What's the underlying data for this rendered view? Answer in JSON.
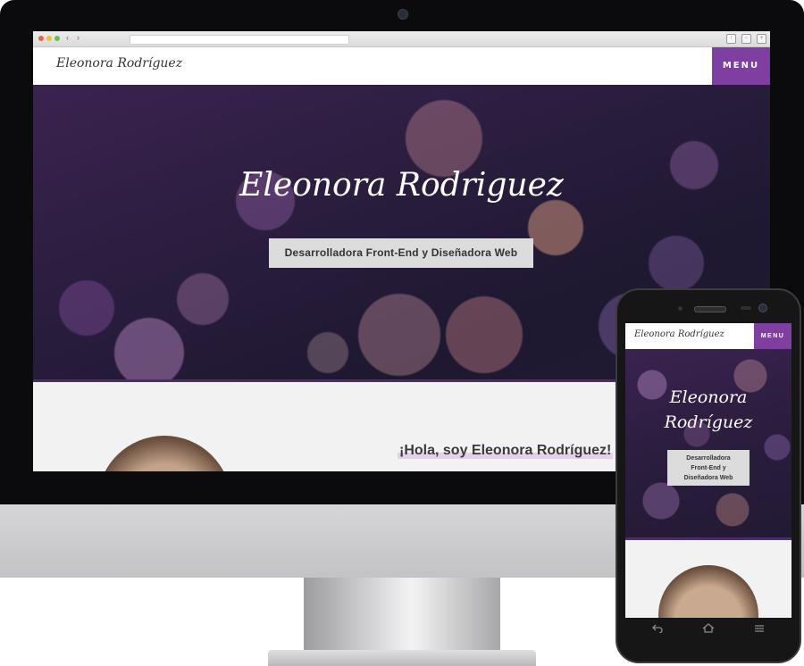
{
  "desktop": {
    "header": {
      "logo": "Eleonora Rodríguez",
      "menu_label": "MENU"
    },
    "hero": {
      "title": "Eleonora Rodriguez",
      "tagline": "Desarrolladora Front-End y Diseñadora Web"
    },
    "about": {
      "heading": "¡Hola, soy Eleonora Rodríguez!"
    }
  },
  "mobile": {
    "header": {
      "logo": "Eleonora Rodríguez",
      "menu_label": "MENU"
    },
    "hero": {
      "title": "Eleonora\nRodríguez",
      "tagline": "Desarrolladora\nFront-End y\nDiseñadora Web"
    }
  },
  "colors": {
    "accent": "#7e3fa0",
    "hero_dark": "#2a1d3e",
    "page_bg": "#f2f2f2"
  },
  "icons": {
    "back": "back-arrow-icon",
    "home": "home-icon",
    "recents": "recents-icon"
  }
}
